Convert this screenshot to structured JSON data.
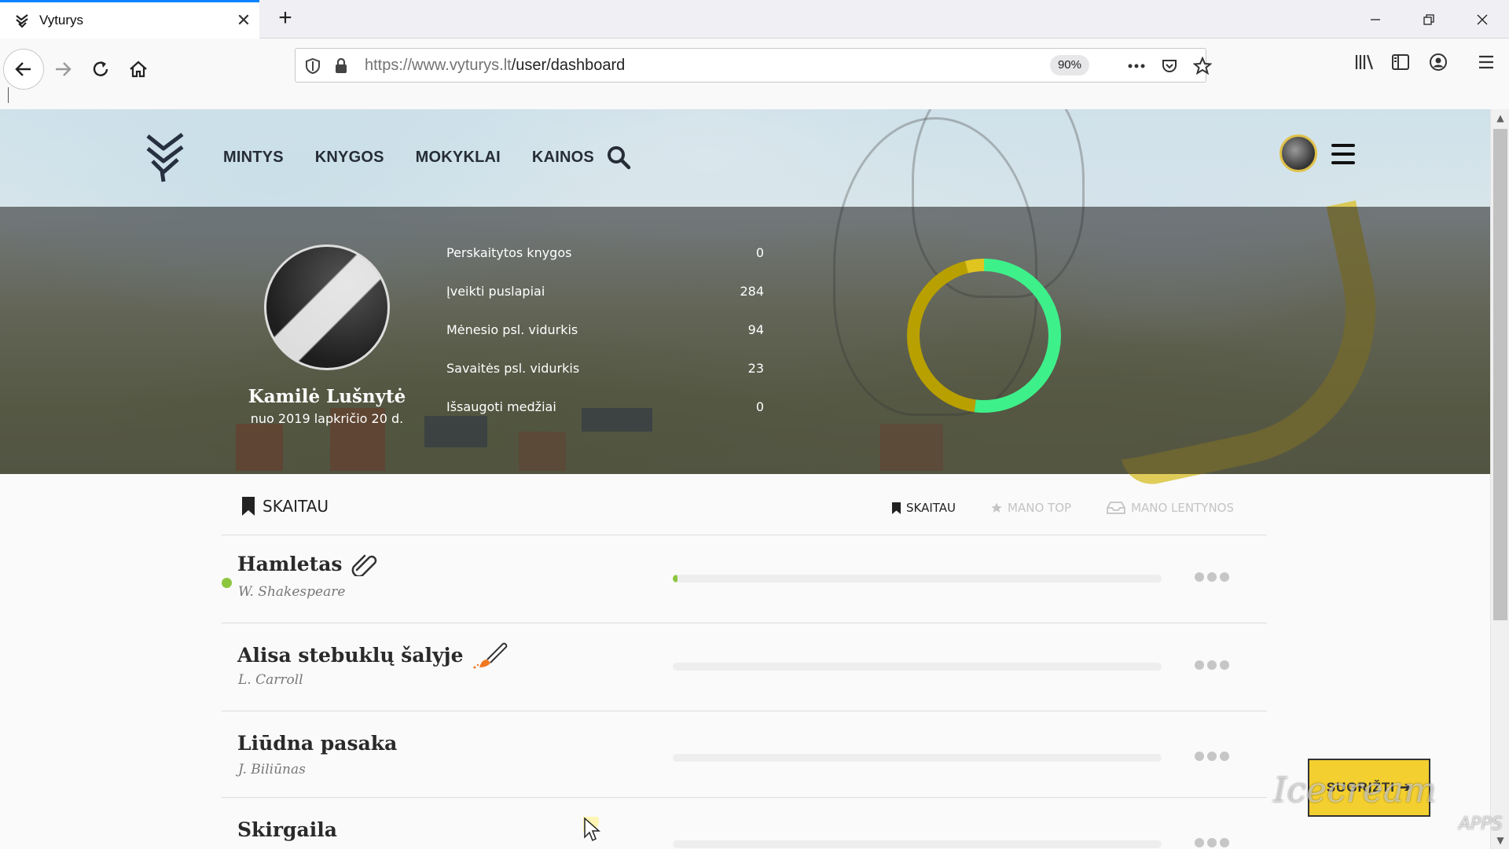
{
  "browser": {
    "tab_title": "Vyturys",
    "url_host": "https://www.vyturys.lt",
    "url_path": "/user/dashboard",
    "zoom": "90%"
  },
  "site": {
    "nav": [
      "MINTYS",
      "KNYGOS",
      "MOKYKLAI",
      "KAINOS"
    ]
  },
  "profile": {
    "name": "Kamilė Lušnytė",
    "since": "nuo 2019 lapkričio 20 d.",
    "stats": [
      {
        "label": "Perskaitytos knygos",
        "value": "0"
      },
      {
        "label": "Įveikti puslapiai",
        "value": "284"
      },
      {
        "label": "Mėnesio psl. vidurkis",
        "value": "94"
      },
      {
        "label": "Savaitės psl. vidurkis",
        "value": "23"
      },
      {
        "label": "Išsaugoti medžiai",
        "value": "0"
      }
    ],
    "donut": {
      "segments": [
        {
          "fraction": 0.52,
          "color": "#3ef08a"
        },
        {
          "fraction": 0.44,
          "color": "#b8a000"
        },
        {
          "fraction": 0.04,
          "color": "#e0c420"
        }
      ]
    }
  },
  "reading": {
    "section_title": "SKAITAU",
    "tabs": [
      "SKAITAU",
      "MANO TOP",
      "MANO LENTYNOS"
    ],
    "books": [
      {
        "title": "Hamletas",
        "author": "W. Shakespeare",
        "progress": 0.01,
        "active": true,
        "icon": "paperclip-icon"
      },
      {
        "title": "Alisa stebuklų šalyje",
        "author": "L. Carroll",
        "progress": 0,
        "active": false,
        "icon": "paintbrush-icon"
      },
      {
        "title": "Liūdna pasaka",
        "author": "J. Biliūnas",
        "progress": 0,
        "active": false,
        "icon": ""
      },
      {
        "title": "Skirgaila",
        "author": "",
        "progress": 0,
        "active": false,
        "icon": ""
      }
    ]
  },
  "return_button": "SUGRĮŽTI",
  "watermark": "Icecream",
  "watermark_sub": "APPS",
  "colors": {
    "accent_green": "#8cc63f",
    "button_yellow": "#f3cf2f",
    "firefox_blue": "#0a84ff"
  }
}
